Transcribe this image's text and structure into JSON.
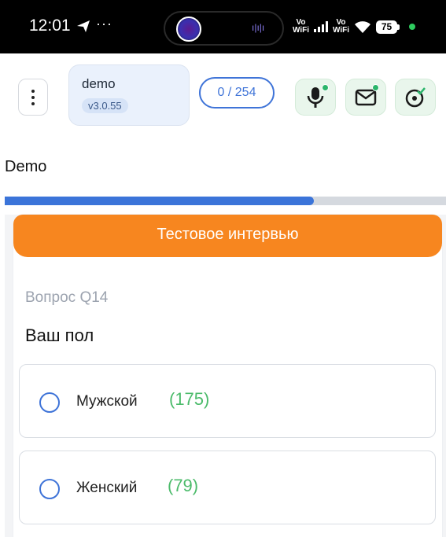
{
  "status_bar": {
    "time": "12:01",
    "dots": "···",
    "vowifi_1": "Vo WiFi",
    "vowifi_2": "Vo WiFi",
    "battery": "75"
  },
  "toolbar": {
    "project_name": "demo",
    "version": "v3.0.55",
    "counter": "0 / 254",
    "icons": [
      "microphone-icon",
      "mail-icon",
      "location-check-icon"
    ]
  },
  "page": {
    "title": "Demo"
  },
  "progress": {
    "fraction": 0.7
  },
  "survey": {
    "header": "Тестовое интервью",
    "question_number": "Вопрос Q14",
    "question_text": "Ваш пол",
    "options": [
      {
        "label": "Мужской",
        "count": "(175)"
      },
      {
        "label": "Женский",
        "count": "(79)"
      }
    ]
  },
  "colors": {
    "accent_blue": "#3f74d8",
    "header_orange": "#f7861f",
    "count_green": "#4cbb6b",
    "icon_green_bg": "#e9f6ec"
  }
}
